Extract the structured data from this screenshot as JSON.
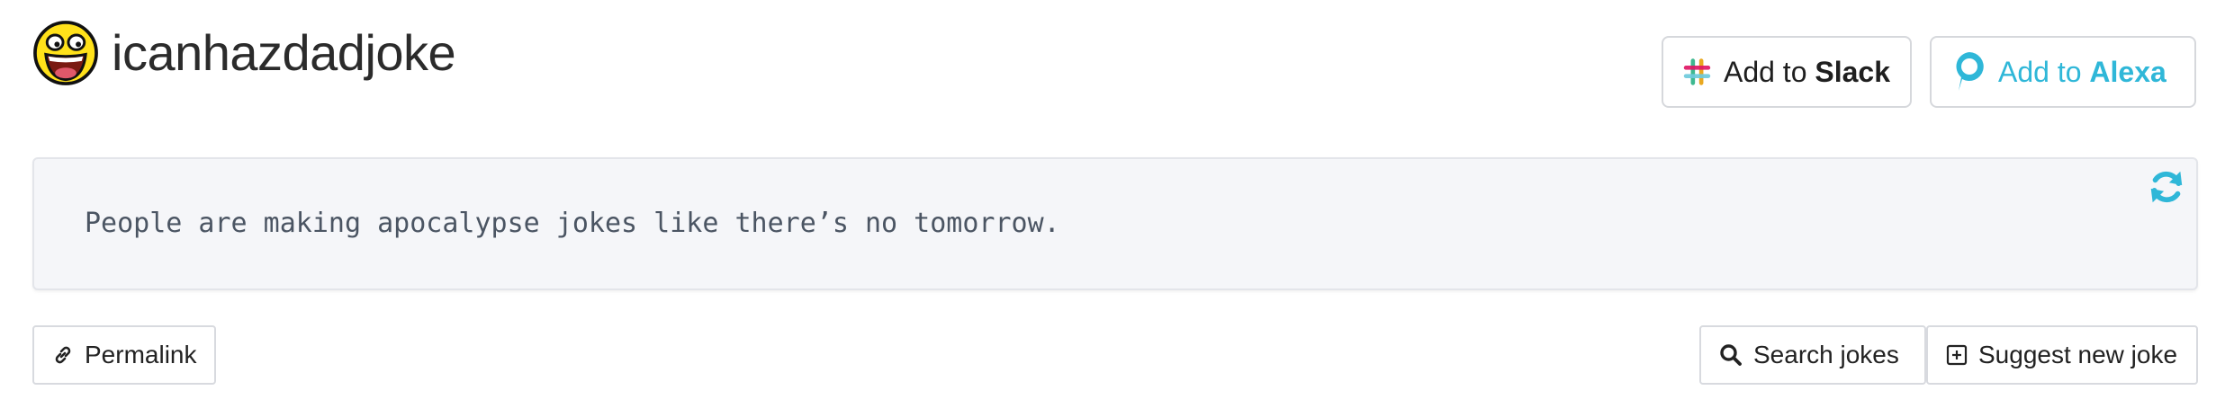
{
  "header": {
    "site_title": "icanhazdadjoke",
    "logo_icon": "awesome-face-icon",
    "slack_button": {
      "prefix": "Add to ",
      "brand": "Slack",
      "icon": "slack-icon"
    },
    "alexa_button": {
      "prefix": "Add to ",
      "brand": "Alexa",
      "icon": "alexa-icon",
      "color": "#2fb7d8"
    }
  },
  "joke": {
    "text": "People are making apocalypse jokes like there’s no tomorrow.",
    "refresh_icon": "refresh-icon",
    "refresh_color": "#2fb7d8"
  },
  "actions": {
    "permalink_label": "Permalink",
    "permalink_icon": "link-icon",
    "search_label": "Search jokes",
    "search_icon": "search-icon",
    "suggest_label": "Suggest new joke",
    "suggest_icon": "plus-square-icon"
  }
}
